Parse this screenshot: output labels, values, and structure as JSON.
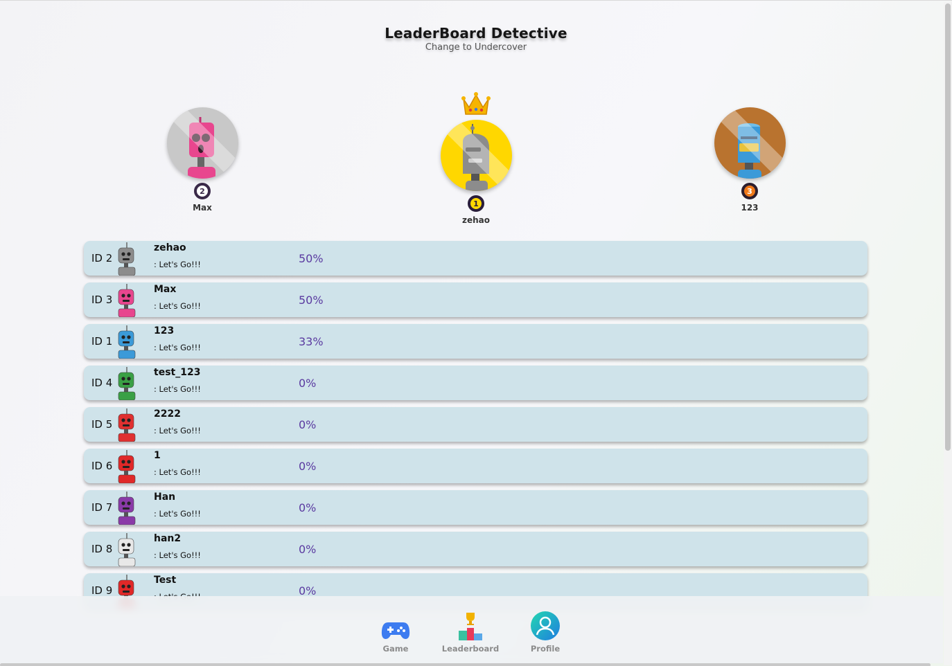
{
  "header": {
    "title": "LeaderBoard Detective",
    "subtitle": "Change to Undercover"
  },
  "podium": [
    {
      "place": "2",
      "name": "Max",
      "color": "#c8c8c8",
      "rank_color": "#3a2948"
    },
    {
      "place": "1",
      "name": "zehao",
      "color": "#ffd700",
      "rank_color": "#2a1e3a"
    },
    {
      "place": "3",
      "name": "123",
      "color": "#b9732f",
      "rank_color": "#2b1e2e"
    }
  ],
  "rows": [
    {
      "id": "ID 2",
      "name": "zehao",
      "message": ": Let's Go!!!",
      "score": "50%",
      "robot_color": "#8c8c8c"
    },
    {
      "id": "ID 3",
      "name": "Max",
      "message": ": Let's Go!!!",
      "score": "50%",
      "robot_color": "#e8468e"
    },
    {
      "id": "ID 1",
      "name": "123",
      "message": ": Let's Go!!!",
      "score": "33%",
      "robot_color": "#3b9ad8"
    },
    {
      "id": "ID 4",
      "name": "test_123",
      "message": ": Let's Go!!!",
      "score": "0%",
      "robot_color": "#3aa045"
    },
    {
      "id": "ID 5",
      "name": "2222",
      "message": ": Let's Go!!!",
      "score": "0%",
      "robot_color": "#e03030"
    },
    {
      "id": "ID 6",
      "name": "1",
      "message": ": Let's Go!!!",
      "score": "0%",
      "robot_color": "#e02828"
    },
    {
      "id": "ID 7",
      "name": "Han",
      "message": ": Let's Go!!!",
      "score": "0%",
      "robot_color": "#8a3aa8"
    },
    {
      "id": "ID 8",
      "name": "han2",
      "message": ": Let's Go!!!",
      "score": "0%",
      "robot_color": "#e8e8e8"
    },
    {
      "id": "ID 9",
      "name": "Test",
      "message": ": Let's Go!!!",
      "score": "0%",
      "robot_color": "#e02828"
    }
  ],
  "nav": {
    "game": "Game",
    "leaderboard": "Leaderboard",
    "profile": "Profile"
  },
  "icons": {
    "crown": "crown-icon",
    "game": "gamepad-icon",
    "leaderboard": "podium-icon",
    "profile": "user-icon"
  }
}
